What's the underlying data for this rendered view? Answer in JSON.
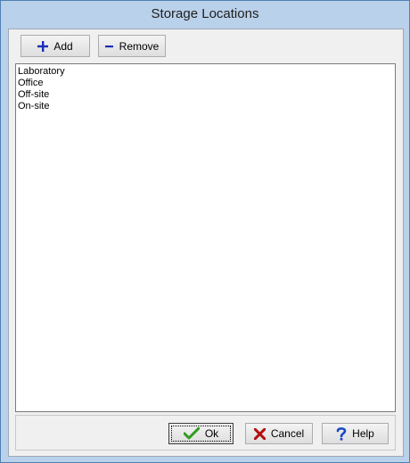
{
  "window": {
    "title": "Storage Locations"
  },
  "toolbar": {
    "add_label": "Add",
    "remove_label": "Remove"
  },
  "list": {
    "items": [
      "Laboratory",
      "Office",
      "Off-site",
      "On-site"
    ]
  },
  "footer": {
    "ok_label": "Ok",
    "cancel_label": "Cancel",
    "help_label": "Help"
  },
  "colors": {
    "add_icon": "#1a2fb8",
    "remove_icon": "#1a2fb8",
    "ok_icon": "#2e9c1e",
    "cancel_icon": "#b01010",
    "help_icon": "#1848c8"
  },
  "icons": [
    "plus-icon",
    "minus-icon",
    "checkmark-icon",
    "x-icon",
    "question-mark-icon"
  ]
}
